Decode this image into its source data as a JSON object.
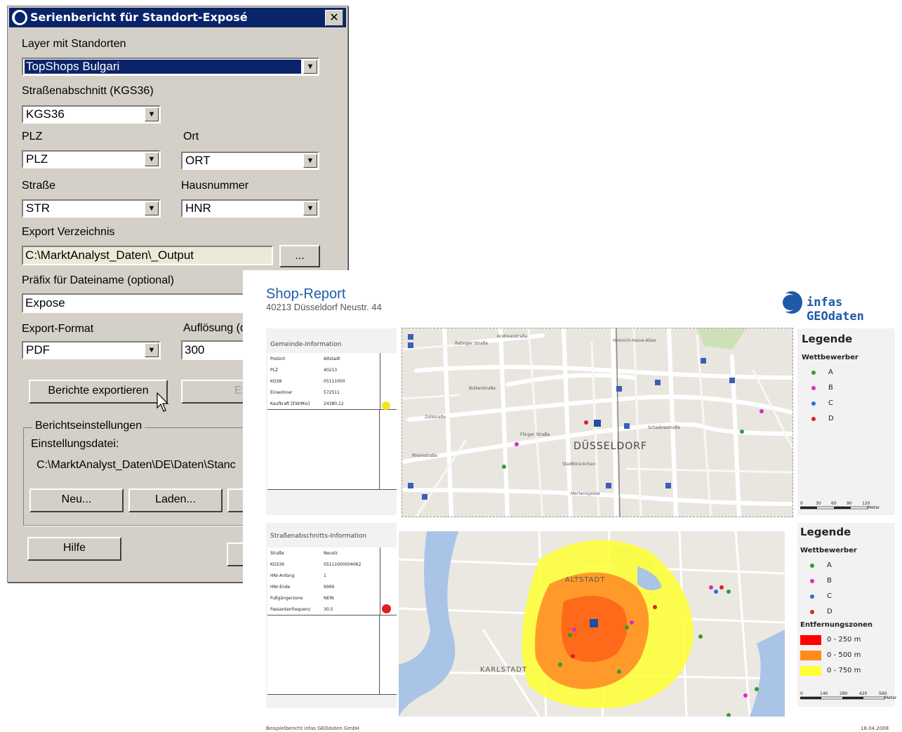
{
  "dialog": {
    "title": "Serienbericht für Standort-Exposé",
    "close_label": "✕",
    "layer": {
      "label": "Layer mit Standorten",
      "value": "TopShops Bulgari"
    },
    "street_section": {
      "label": "Straßenabschnitt (KGS36)",
      "value": "KGS36"
    },
    "plz": {
      "label": "PLZ",
      "value": "PLZ"
    },
    "ort": {
      "label": "Ort",
      "value": "ORT"
    },
    "strasse": {
      "label": "Straße",
      "value": "STR"
    },
    "hausnummer": {
      "label": "Hausnummer",
      "value": "HNR"
    },
    "export_dir": {
      "label": "Export Verzeichnis",
      "value": "C:\\MarktAnalyst_Daten\\_Output",
      "browse_label": "..."
    },
    "prefix": {
      "label": "Präfix für Dateiname (optional)",
      "value": "Expose"
    },
    "export_format": {
      "label": "Export-Format",
      "value": "PDF"
    },
    "resolution": {
      "label": "Auflösung (d",
      "value": "300"
    },
    "buttons": {
      "export_reports": "Berichte exportieren",
      "export": "Export"
    },
    "report_settings": {
      "group_title": "Berichtseinstellungen",
      "settings_file_label": "Einstellungsdatei:",
      "settings_file_path": "C:\\MarktAnalyst_Daten\\DE\\Daten\\Stanc",
      "new_button": "Neu...",
      "load_button": "Laden..."
    },
    "help_button": "Hilfe"
  },
  "report": {
    "title": "Shop-Report",
    "subtitle": "40213 Düsseldorf Neustr. 44",
    "logo_text": "infas GEOdaten",
    "municipality": {
      "title": "Gemeinde-Information",
      "rows": [
        {
          "key": "Postort",
          "value": "Altstadt"
        },
        {
          "key": "PLZ",
          "value": "40213"
        },
        {
          "key": "KGS8",
          "value": "05111000"
        },
        {
          "key": "Einwohner",
          "value": "572511"
        },
        {
          "key": "Kaufkraft [EW/Mio]",
          "value": "24380,12"
        }
      ]
    },
    "street_info": {
      "title": "Straßenabschnitts-Information",
      "rows": [
        {
          "key": "Straße",
          "value": "Neustr."
        },
        {
          "key": "KGS36",
          "value": "05111000004062"
        },
        {
          "key": "HNr-Anfang",
          "value": "1"
        },
        {
          "key": "HNr-Ende",
          "value": "9999"
        },
        {
          "key": "Fußgängerzone",
          "value": "NEIN"
        },
        {
          "key": "Passantenfrequenz",
          "value": "30,5"
        }
      ]
    },
    "map1": {
      "city_label": "DÜSSELDORF",
      "streets": [
        "Ratinger Straße",
        "Andreasstraße",
        "Bolkerstraße",
        "Zollstraße",
        "Flinger Straße",
        "Rheinstraße",
        "Schadowstraße",
        "Stadtbrückchen",
        "Mertensgasse",
        "Heinrich-Heine-Allee"
      ]
    },
    "map2": {
      "labels": [
        "ALTSTADT",
        "KARLSTADT"
      ]
    },
    "legend1": {
      "title": "Legende",
      "subtitle": "Wettbewerber",
      "items": [
        {
          "label": "A",
          "color": "#2ca02c"
        },
        {
          "label": "B",
          "color": "#d62dc6"
        },
        {
          "label": "C",
          "color": "#1f77d4"
        },
        {
          "label": "D",
          "color": "#e02020"
        }
      ],
      "scale": [
        "0",
        "30",
        "60",
        "90",
        "120"
      ],
      "scale_unit": "Meter"
    },
    "legend2": {
      "title": "Legende",
      "subtitle": "Wettbewerber",
      "items": [
        {
          "label": "A",
          "color": "#2ca02c"
        },
        {
          "label": "B",
          "color": "#d62dc6"
        },
        {
          "label": "C",
          "color": "#1f77d4"
        },
        {
          "label": "D",
          "color": "#e02020"
        }
      ],
      "zones_title": "Entfernungszonen",
      "zones": [
        {
          "label": "0 - 250 m",
          "color": "#ff0000"
        },
        {
          "label": "0 - 500 m",
          "color": "#ff8c1a"
        },
        {
          "label": "0 - 750 m",
          "color": "#ffff33"
        }
      ],
      "scale": [
        "0",
        "140",
        "280",
        "420",
        "560"
      ],
      "scale_unit": "Meter"
    },
    "footer_left": "Beispielbericht infas GEOdaten GmbH",
    "footer_right": "18.04.2008"
  }
}
